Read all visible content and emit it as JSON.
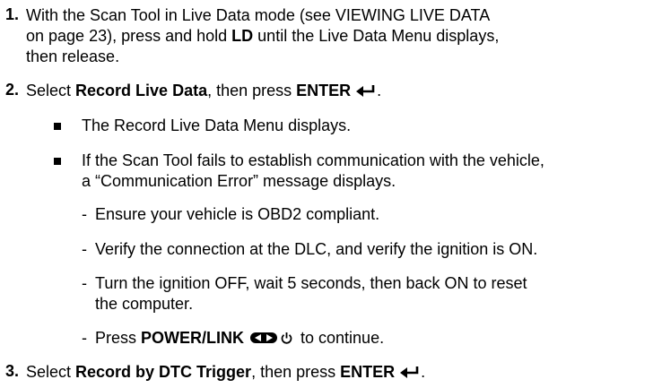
{
  "step1": {
    "number": "1.",
    "line1": "With the Scan Tool in Live Data mode (see VIEWING LIVE DATA",
    "line2_a": "on page 23), press and hold ",
    "line2_b": "LD",
    "line2_c": " until the Live Data Menu displays,",
    "line3": "then release."
  },
  "step2": {
    "number": "2.",
    "text_a": "Select ",
    "text_b": "Record Live Data",
    "text_c": ", then press ",
    "text_d": "ENTER",
    "text_e": ".",
    "bullet1": "The Record Live Data Menu displays.",
    "bullet2_line1": "If the Scan Tool fails to establish communication with the vehicle,",
    "bullet2_line2": "a “Communication Error” message displays.",
    "dash1": "Ensure your vehicle is OBD2 compliant.",
    "dash2": "Verify the connection at the DLC, and verify the ignition is ON.",
    "dash3_line1": "Turn the ignition OFF, wait 5 seconds, then back ON to reset",
    "dash3_line2": "the computer.",
    "dash4_a": "Press ",
    "dash4_b": "POWER/LINK",
    "dash4_c": " to continue."
  },
  "step3": {
    "number": "3.",
    "text_a": "Select ",
    "text_b": "Record by DTC Trigger",
    "text_c": ", then press ",
    "text_d": "ENTER",
    "text_e": "."
  },
  "icons": {
    "enter": "enter-icon",
    "link": "link-icon",
    "power": "power-icon"
  }
}
